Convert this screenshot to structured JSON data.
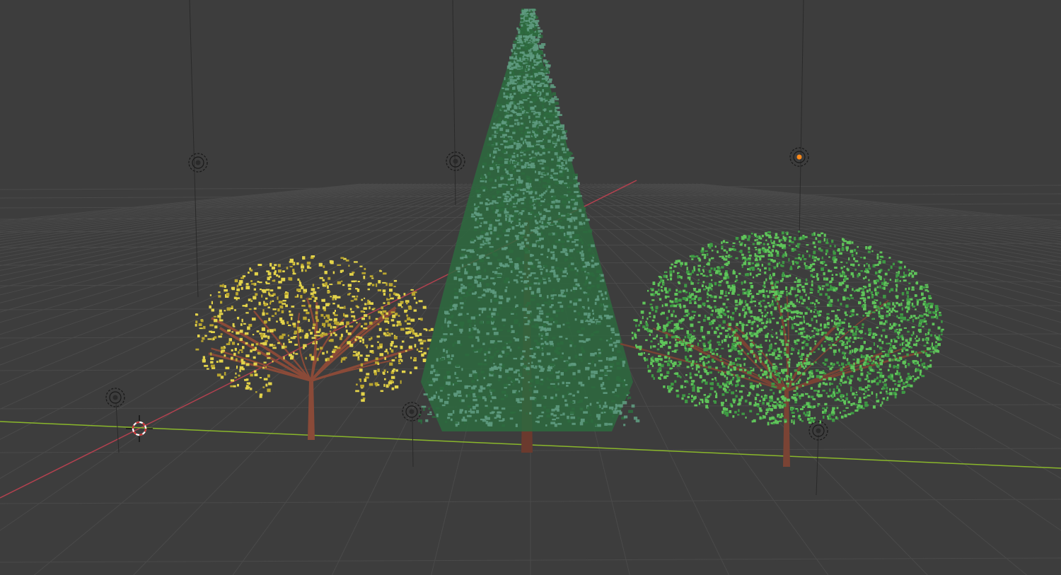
{
  "viewport": {
    "background": "#3d3d3d",
    "grid_color": "#4a4a4a",
    "x_axis_color": "#b3414f",
    "y_axis_color": "#8ab72b"
  },
  "objects": [
    {
      "name": "birch-tree",
      "kind": "tree",
      "crown": "broadleaf",
      "leaf_color": "#e3d34a",
      "leaf_color_dark": "#b9a52f",
      "trunk_color": "#8a4a38"
    },
    {
      "name": "spruce-tree",
      "kind": "tree",
      "crown": "conifer",
      "leaf_color": "#5e9a80",
      "leaf_color_dark": "#2d6a3e",
      "trunk_color": "#6b3a2e"
    },
    {
      "name": "oak-tree",
      "kind": "tree",
      "crown": "broadleaf",
      "leaf_color": "#5fc45a",
      "leaf_color_dark": "#3e9a44",
      "trunk_color": "#7a4334"
    }
  ],
  "lights": [
    {
      "name": "light-left",
      "icon": "point-light-icon",
      "selected": false
    },
    {
      "name": "light-center",
      "icon": "point-light-icon",
      "selected": false
    },
    {
      "name": "light-right",
      "icon": "point-light-icon",
      "selected": true
    },
    {
      "name": "light-ground-left",
      "icon": "point-light-icon",
      "selected": false
    },
    {
      "name": "light-ground-center",
      "icon": "point-light-icon",
      "selected": false
    },
    {
      "name": "light-ground-right",
      "icon": "point-light-icon",
      "selected": false
    }
  ],
  "cursor": {
    "icon": "3d-cursor-icon",
    "colors": [
      "#cc3333",
      "#ffffff"
    ]
  },
  "selection_color": "#ff8a1a"
}
